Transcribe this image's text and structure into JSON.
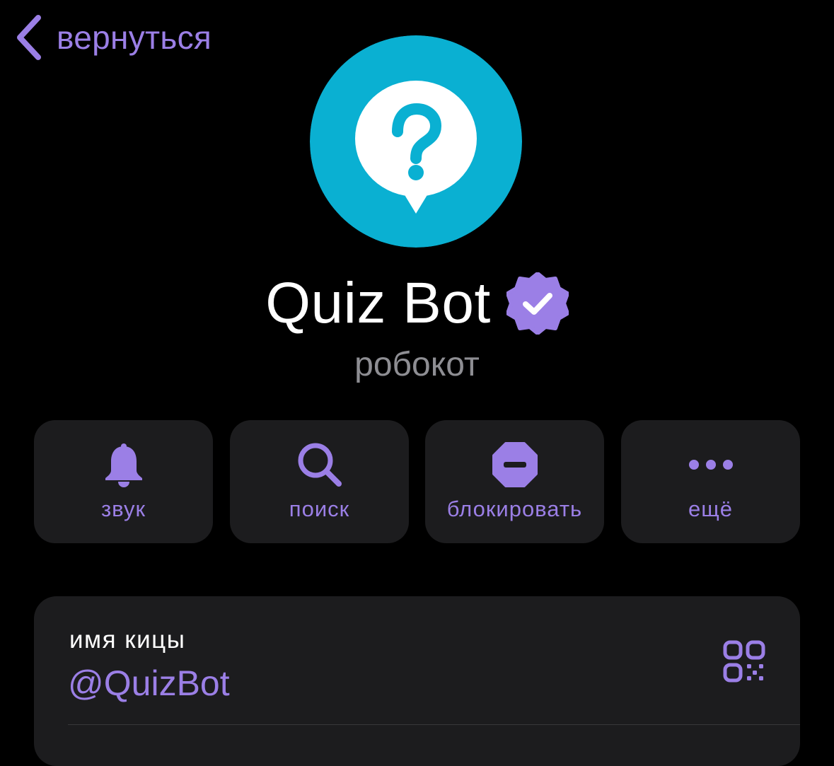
{
  "nav": {
    "back_label": "вернуться",
    "back_icon": "chevron-left-icon"
  },
  "profile": {
    "avatar_icon": "question-bubble-icon",
    "name": "Quiz Bot",
    "verified_icon": "verified-badge-icon",
    "subtitle": "робокот"
  },
  "actions": [
    {
      "label": "звук",
      "icon": "bell-icon"
    },
    {
      "label": "поиск",
      "icon": "search-icon"
    },
    {
      "label": "блокировать",
      "icon": "block-icon"
    },
    {
      "label": "ещё",
      "icon": "more-icon"
    }
  ],
  "info": {
    "username_label": "имя кицы",
    "username_value": "@QuizBot",
    "qr_icon": "qr-code-icon"
  },
  "colors": {
    "background": "#000000",
    "card": "#1c1c1e",
    "accent": "#9b7fe6",
    "avatar_bg": "#0ab0d2",
    "secondary_text": "#8e8e93"
  }
}
